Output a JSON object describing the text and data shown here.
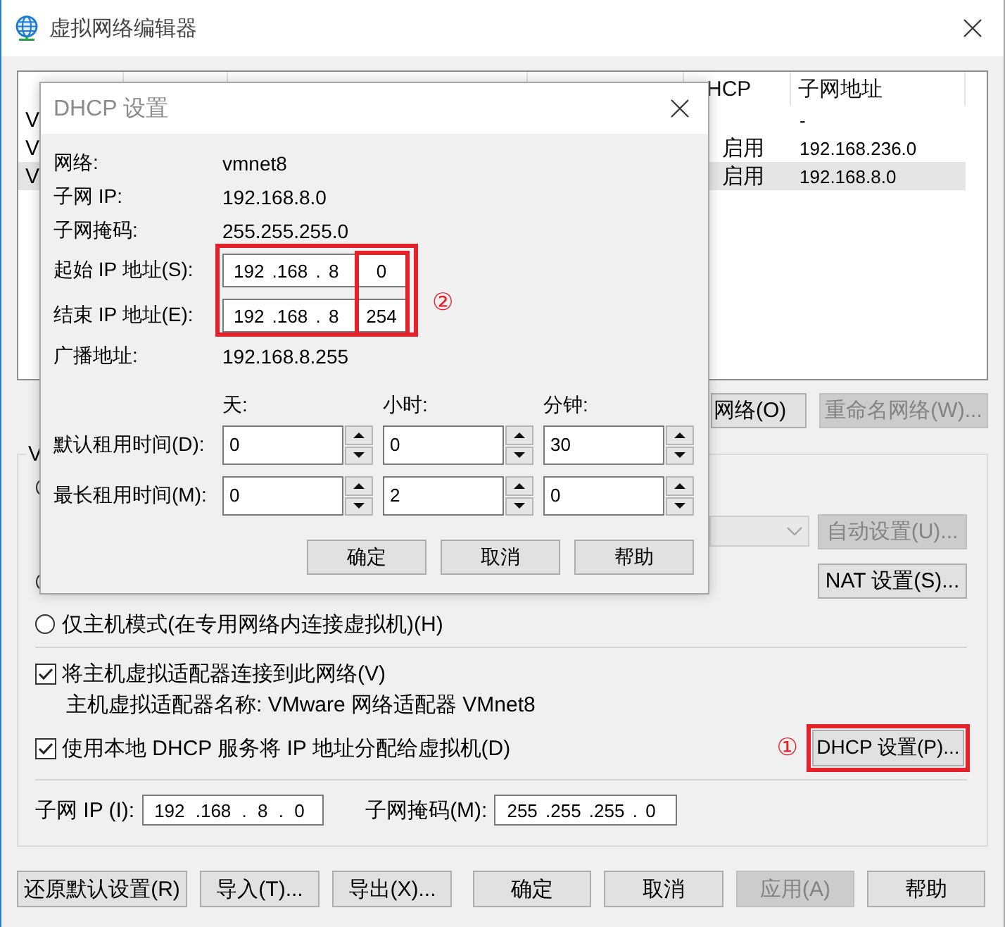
{
  "window": {
    "title": "虚拟网络编辑器"
  },
  "network_table": {
    "columns": [
      "HCP",
      "子网地址"
    ],
    "rows": [
      {
        "column_1": "V",
        "subnet_address": "-",
        "selected": false
      },
      {
        "column_1": "V",
        "dhcp": "启用",
        "subnet_address": "192.168.236.0",
        "selected": false
      },
      {
        "column_1": "V",
        "dhcp": "启用",
        "subnet_address": "192.168.8.0",
        "selected": true
      }
    ]
  },
  "table_buttons": [
    {
      "label": "网络(O)",
      "disabled": false
    },
    {
      "label": "重命名网络(W)...",
      "disabled": true
    }
  ],
  "vmnet_info": {
    "title": "V",
    "dropdown": {
      "disabled": true
    },
    "buttons": [
      {
        "label": "自动设置(U)...",
        "disabled": true
      },
      {
        "label": "NAT 设置(S)...",
        "disabled": false
      }
    ],
    "host_only_mode": {
      "label": "仅主机模式(在专用网络内连接虚拟机)(H)",
      "selected": false
    },
    "connect_adapter": {
      "label": "将主机虚拟适配器连接到此网络(V)",
      "checked": true
    },
    "adapter_name": "主机虚拟适配器名称: VMware 网络适配器 VMnet8",
    "use_dhcp": {
      "label": "使用本地 DHCP 服务将 IP 地址分配给虚拟机(D)",
      "checked": true
    },
    "dhcp_button": {
      "label": "DHCP 设置(P)...",
      "disabled": false,
      "highlighted": true,
      "annotation": "①"
    },
    "subnet_ip": {
      "label": "子网 IP (I):",
      "value": "192 .168 . 8 . 0"
    },
    "subnet_mask": {
      "label": "子网掩码(M):",
      "value": "255 .255 .255 . 0"
    }
  },
  "footer_buttons": [
    {
      "label": "还原默认设置(R)",
      "disabled": false
    },
    {
      "label": "导入(T)...",
      "disabled": false
    },
    {
      "label": "导出(X)...",
      "disabled": false
    },
    {
      "label": "确定",
      "disabled": false
    },
    {
      "label": "取消",
      "disabled": false
    },
    {
      "label": "应用(A)",
      "disabled": true
    },
    {
      "label": "帮助",
      "disabled": false
    }
  ],
  "dhcp_dialog": {
    "title": "DHCP 设置",
    "info": [
      {
        "label": "网络:",
        "value": "vmnet8"
      },
      {
        "label": "子网 IP:",
        "value": "192.168.8.0"
      },
      {
        "label": "子网掩码:",
        "value": "255.255.255.0"
      }
    ],
    "ip_range": {
      "highlighted": true,
      "annotation": "②",
      "rows": [
        {
          "label": "起始 IP 地址(S):",
          "prefix": "192 .168 . 8",
          "last_octet": "0"
        },
        {
          "label": "结束 IP 地址(E):",
          "prefix": "192 .168 . 8",
          "last_octet": "254"
        }
      ]
    },
    "broadcast": {
      "label": "广播地址:",
      "value": "192.168.8.255"
    },
    "lease": {
      "units": [
        "天:",
        "小时:",
        "分钟:"
      ],
      "rows": [
        {
          "label": "默认租用时间(D):",
          "values": [
            "0",
            "0",
            "30"
          ]
        },
        {
          "label": "最长租用时间(M):",
          "values": [
            "0",
            "2",
            "0"
          ]
        }
      ]
    },
    "buttons": [
      "确定",
      "取消",
      "帮助"
    ]
  }
}
